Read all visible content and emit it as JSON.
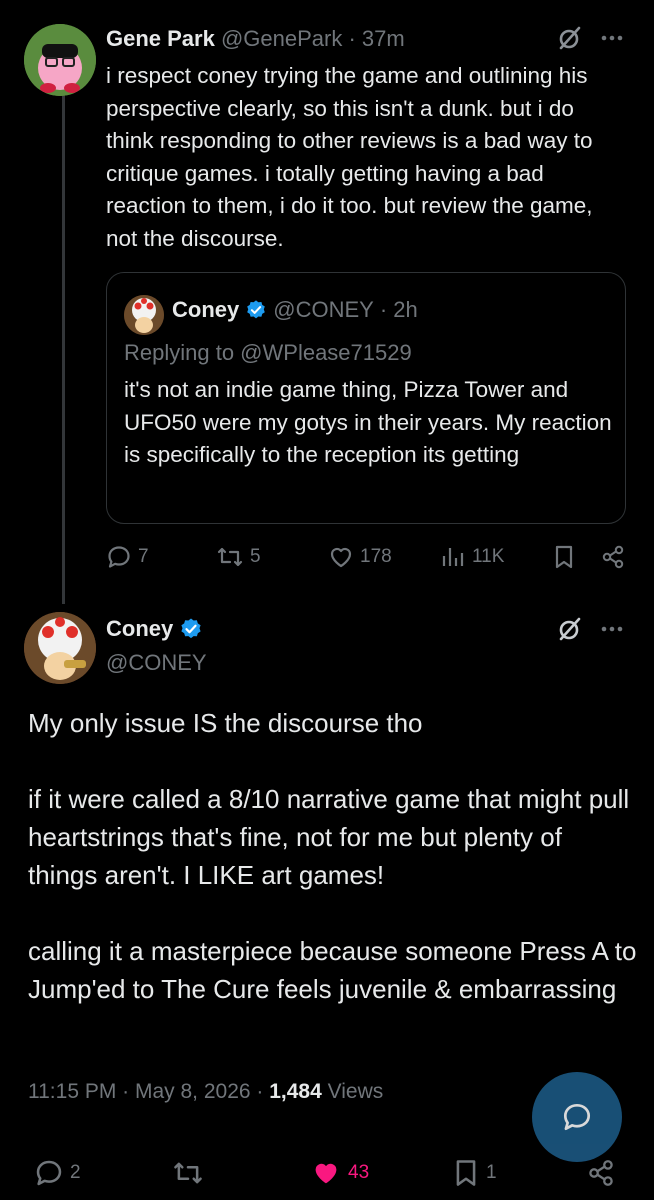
{
  "tweet1": {
    "name": "Gene Park",
    "handle": "@GenePark",
    "time": "· 37m",
    "text": "i respect coney trying the game and outlining his perspective clearly, so this isn't a dunk. but i do think responding to other reviews is a bad way to critique games. i totally getting having a bad reaction to them, i do it too. but review the game, not the discourse.",
    "quote": {
      "name": "Coney",
      "handle": "@CONEY",
      "time": "· 2h",
      "replying_to": "Replying to @WPlease71529",
      "text": "it's not an indie game thing, Pizza Tower and UFO50 were my gotys in their years. My reaction is specifically to the reception its getting"
    },
    "stats": {
      "replies": "7",
      "reposts": "5",
      "likes": "178",
      "views": "11K"
    }
  },
  "tweet2": {
    "name": "Coney",
    "handle": "@CONEY",
    "text": "My only issue IS the discourse tho\n\nif it were called a 8/10 narrative game that might pull heartstrings that's fine, not for me but plenty of things aren't. I LIKE art games!\n\ncalling it a masterpiece because someone Press A to Jump'ed to The Cure feels juvenile & embarrassing",
    "timestamp": "11:15 PM · May 8, 2026 · ",
    "views_count": "1,484",
    "views_label": " Views",
    "stats": {
      "replies": "2",
      "likes": "43",
      "bookmarks": "1"
    }
  },
  "colors": {
    "background": "#000000",
    "text": "#e7e9ea",
    "muted": "#71767b",
    "verified": "#1d9bf0",
    "like": "#f91880"
  }
}
